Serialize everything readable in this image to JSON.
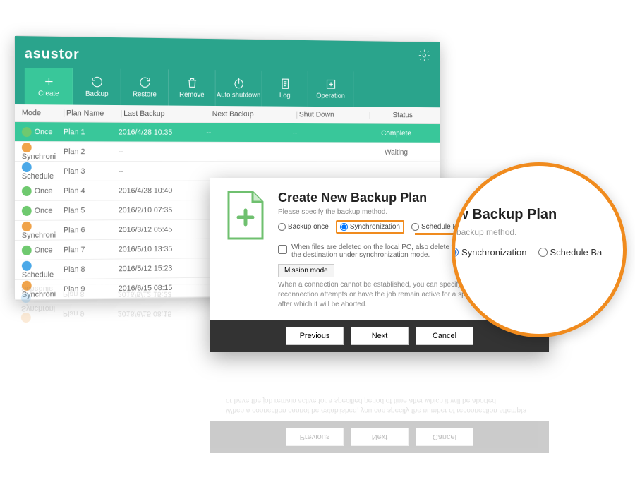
{
  "brand": "asustor",
  "toolbar": {
    "create": "Create",
    "backup": "Backup",
    "restore": "Restore",
    "remove": "Remove",
    "auto_shutdown": "Auto shutdown",
    "log": "Log",
    "operation": "Operation"
  },
  "columns": {
    "mode": "Mode",
    "plan_name": "Plan Name",
    "last_backup": "Last Backup",
    "next_backup": "Next Backup",
    "shut_down": "Shut Down",
    "status": "Status"
  },
  "rows": [
    {
      "mode": "Once",
      "icon": "once",
      "plan": "Plan 1",
      "last": "2016/4/28 10:35",
      "next": "--",
      "shut": "--",
      "status": "Complete",
      "selected": true
    },
    {
      "mode": "Synchroni",
      "icon": "sync",
      "plan": "Plan 2",
      "last": "--",
      "next": "--",
      "shut": "",
      "status": "Waiting"
    },
    {
      "mode": "Schedule",
      "icon": "sched",
      "plan": "Plan 3",
      "last": "--",
      "next": "",
      "shut": "",
      "status": ""
    },
    {
      "mode": "Once",
      "icon": "once",
      "plan": "Plan 4",
      "last": "2016/4/28 10:40",
      "next": "",
      "shut": "",
      "status": ""
    },
    {
      "mode": "Once",
      "icon": "once",
      "plan": "Plan 5",
      "last": "2016/2/10 07:35",
      "next": "",
      "shut": "",
      "status": ""
    },
    {
      "mode": "Synchroni",
      "icon": "sync",
      "plan": "Plan 6",
      "last": "2016/3/12 05:45",
      "next": "",
      "shut": "",
      "status": ""
    },
    {
      "mode": "Once",
      "icon": "once",
      "plan": "Plan 7",
      "last": "2016/5/10 13:35",
      "next": "",
      "shut": "",
      "status": ""
    },
    {
      "mode": "Schedule",
      "icon": "sched",
      "plan": "Plan 8",
      "last": "2016/5/12 15:23",
      "next": "",
      "shut": "",
      "status": ""
    },
    {
      "mode": "Synchroni",
      "icon": "sync",
      "plan": "Plan 9",
      "last": "2016/6/15 08:15",
      "next": "",
      "shut": "",
      "status": ""
    }
  ],
  "dialog": {
    "title": "Create New Backup Plan",
    "subtitle": "Please specify the backup method.",
    "opt_once": "Backup once",
    "opt_sync": "Synchronization",
    "opt_sched": "Schedule Backup",
    "check_text": "When files are deleted on the local PC, also delete the corresponding files at the destination under synchronization mode.",
    "mission_btn": "Mission mode",
    "mission_text": "When a connection cannot be established, you can specify the number of reconnection attempts or have the job remain active for a specified period of time after which it will be aborted.",
    "previous": "Previous",
    "next": "Next",
    "cancel": "Cancel"
  },
  "magnifier": {
    "title_fragment": "ew Backup Plan",
    "subtitle_fragment": "e backup method.",
    "opt_sync": "Synchronization",
    "opt_sched_fragment": "Schedule Ba"
  }
}
